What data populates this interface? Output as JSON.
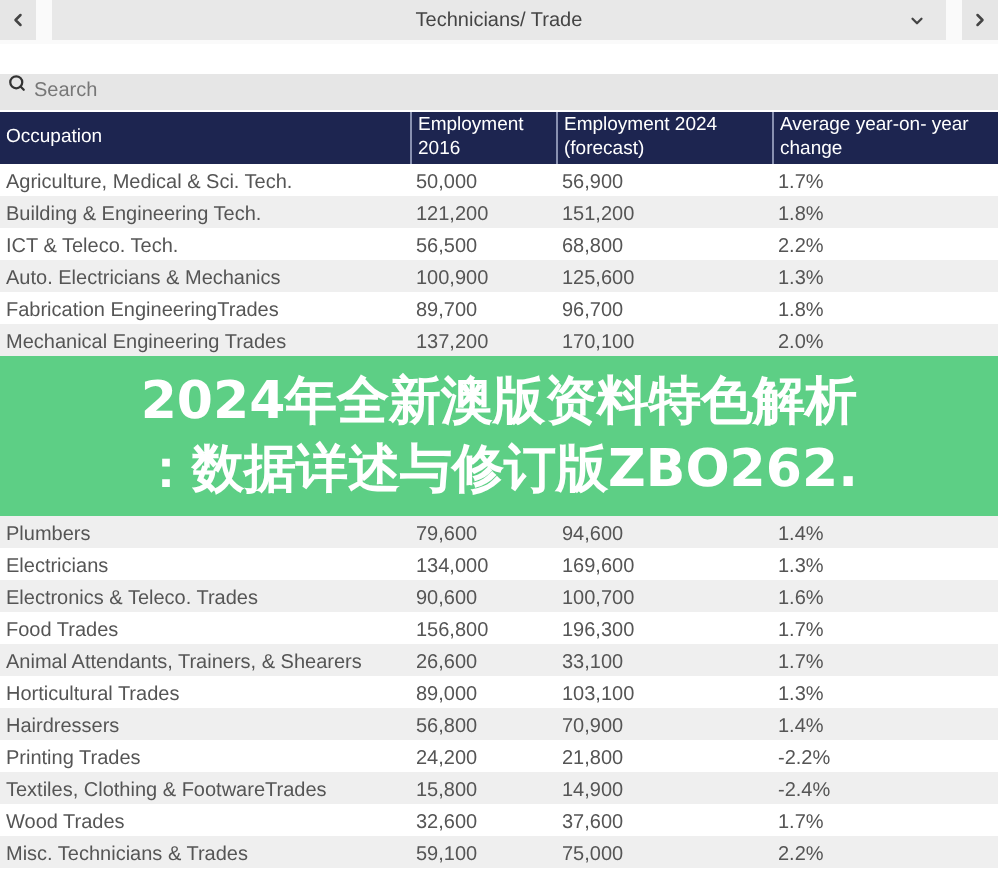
{
  "selector": {
    "label": "Technicians/ Trade"
  },
  "search": {
    "placeholder": "Search"
  },
  "table": {
    "columns": [
      "Occupation",
      "Employment 2016",
      "Employment 2024 (forecast)",
      "Average year-on- year change"
    ],
    "rows_above": [
      [
        "Agriculture, Medical & Sci. Tech.",
        "50,000",
        "56,900",
        "1.7%"
      ],
      [
        "Building & Engineering Tech.",
        "121,200",
        "151,200",
        "1.8%"
      ],
      [
        "ICT & Teleco. Tech.",
        "56,500",
        "68,800",
        "2.2%"
      ],
      [
        "Auto. Electricians & Mechanics",
        "100,900",
        "125,600",
        "1.3%"
      ],
      [
        "Fabrication EngineeringTrades",
        "89,700",
        "96,700",
        "1.8%"
      ],
      [
        "Mechanical Engineering Trades",
        "137,200",
        "170,100",
        "2.0%"
      ]
    ],
    "rows_below": [
      [
        "Plumbers",
        "79,600",
        "94,600",
        "1.4%"
      ],
      [
        "Electricians",
        "134,000",
        "169,600",
        "1.3%"
      ],
      [
        "Electronics & Teleco. Trades",
        "90,600",
        "100,700",
        "1.6%"
      ],
      [
        "Food Trades",
        "156,800",
        "196,300",
        "1.7%"
      ],
      [
        "Animal Attendants, Trainers, & Shearers",
        "26,600",
        "33,100",
        "1.7%"
      ],
      [
        "Horticultural Trades",
        "89,000",
        "103,100",
        "1.3%"
      ],
      [
        "Hairdressers",
        "56,800",
        "70,900",
        "1.4%"
      ],
      [
        "Printing Trades",
        "24,200",
        "21,800",
        "-2.2%"
      ],
      [
        "Textiles, Clothing & FootwareTrades",
        "15,800",
        "14,900",
        "-2.4%"
      ],
      [
        "Wood Trades",
        "32,600",
        "37,600",
        "1.7%"
      ],
      [
        "Misc. Technicians & Trades",
        "59,100",
        "75,000",
        "2.2%"
      ]
    ]
  },
  "banner": {
    "lines": [
      "2024年全新澳版资料特色解析",
      "：数据详述与修订版ZBO262."
    ]
  }
}
